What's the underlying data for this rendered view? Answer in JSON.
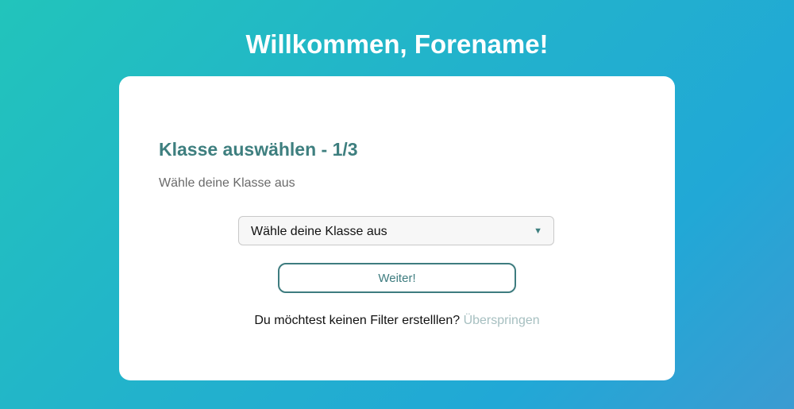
{
  "header": {
    "welcome": "Willkommen, Forename!"
  },
  "card": {
    "step_title": "Klasse auswählen - 1/3",
    "step_description": "Wähle deine Klasse aus",
    "class_select": {
      "selected_value": "Wähle deine Klasse aus",
      "caret_icon": "triangle-down-icon"
    },
    "next_button_label": "Weiter!",
    "skip_prompt": "Du möchtest keinen Filter erstelllen?",
    "skip_link_label": "Überspringen"
  },
  "colors": {
    "accent": "#3e7f7f",
    "skip_link": "#a6bfc0",
    "gradient_start": "#22c4bb",
    "gradient_end": "#3b9bd2"
  }
}
